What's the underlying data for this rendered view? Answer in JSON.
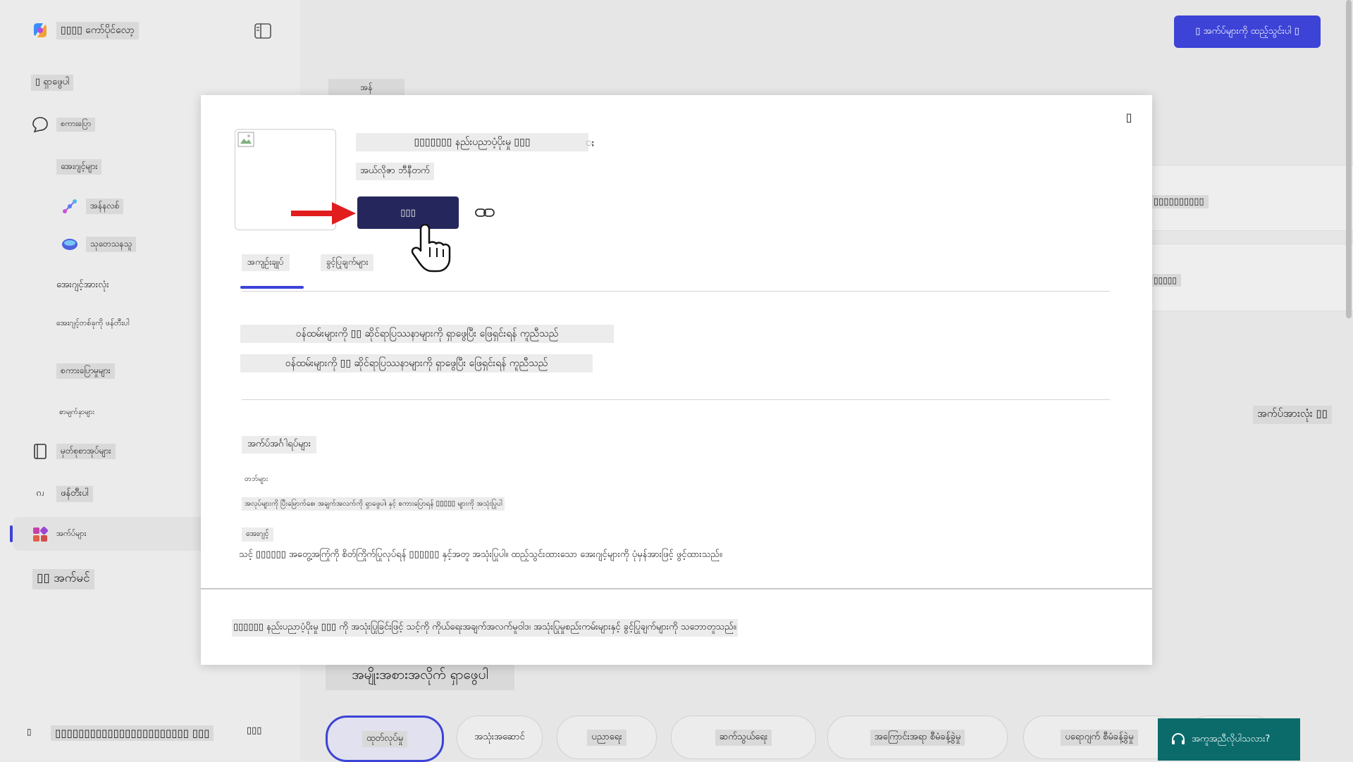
{
  "sidebar": {
    "brand": "▯▯▯▯ ကော်ပိုင်လော့",
    "search": "▯ ရှာဖွေပါ",
    "chat": "စကားပြော",
    "agents": "အေးဂျင့်များ",
    "researcher": "အန်နလစ်",
    "analyst": "သုတေသနသူ",
    "all_agents": "အေးဂျင့်အားလုံး",
    "create_agent": "အေးဂျင့်တစ်ခုကို ဖန်တီးပါ",
    "conversations": "စကားပြောမှုများ",
    "recent": "စာမျက်နှာများ",
    "notebooks": "မှတ်စုစာအုပ်များ",
    "create": "ဖန်တီးပါ",
    "apps": "အက်ပ်များ",
    "more_apps": "▯▯ အက်မင်",
    "user_name": "▯▯▯▯▯▯▯▯▯▯▯▯▯▯▯▯▯▯▯▯▯▯▯ ▯▯▯",
    "user_menu": "▯▯▯"
  },
  "main": {
    "top_button": "▯ အက်ပ်များကို ထည့်သွင်းပါ ▯",
    "tab_label": "အန်",
    "card1": "▯▯▯▯▯▯▯▯▯▯",
    "card2": "▯▯▯▯▯",
    "see_all": "အက်ပ်အားလုံး ▯▯",
    "browse_heading": "အမျိုးအစားအလိုက် ရှာဖွေပါ",
    "categories": [
      "ထုတ်လုပ်မှု",
      "အသုံးအဆောင်",
      "ပညာရေး",
      "ဆက်သွယ်ရေး",
      "အကြောင်းအရာ စီမံခန့်ခွဲမှု",
      "ပရောဂျက် စီမံခန့်ခွဲမှု"
    ],
    "help": "အကူအညီလိုပါသလား?"
  },
  "modal": {
    "close": "▯",
    "title": "▯▯▯▯▯▯▯ နည်းပညာပံ့ပိုးမှု ▯▯▯",
    "title_suffix": "ႈ",
    "publisher": "အယ်လိုဇာ ဘီနီတက်",
    "add_button": "▯▯▯",
    "tabs": [
      "အကျဉ်းချုပ်",
      "ခွင့်ပြုချက်များ"
    ],
    "desc1": "ဝန်ထမ်းများကို ▯▯ ဆိုင်ရာပြဿနာများကို ရှာဖွေပြီး ဖြေရှင်းရန် ကူညီသည်",
    "desc2": "ဝန်ထမ်းများကို ▯▯ ဆိုင်ရာပြဿနာများကို ရှာဖွေပြီး ဖြေရှင်းရန် ကူညီသည်",
    "features_heading": "အက်ပ်အင်္ဂါရပ်များ",
    "tabs_label": "တဘ်များ",
    "tabs_desc": "အလုပ်များကို ပြီးမြောက်စေ၊ အချက်အလက်ကို ရှာဖွေပါ၊ နှင့် စကားပြောရန် ▯▯▯▯▯ များကို အသုံးပြုပါ",
    "agent_label": "အေးဂျင့်",
    "agent_desc": "သင့် ▯▯▯▯▯▯ အတွေ့အကြုံကို စိတ်ကြိုက်ပြုလုပ်ရန် ▯▯▯▯▯▯ နှင့်အတူ အသုံးပြုပါ။ ထည့်သွင်းထားသော အေးဂျင့်များကို ပုံမှန်အားဖြင့် ဖွင့်ထားသည်။",
    "footer": "▯▯▯▯▯▯ နည်းပညာပံ့ပိုးမှု ▯▯▯ ကို အသုံးပြုခြင်းဖြင့် သင့်ကို ကိုယ်ရေးအချက်အလက်မူဝါဒ၊ အသုံးပြုမှုစည်းကမ်းများနှင့် ခွင့်ပြုချက်များကို သဘောတူသည်။"
  },
  "colors": {
    "accent": "#3b43d6",
    "add_button": "#25275c",
    "arrow": "#e11d1d",
    "help": "#0b6b6b"
  }
}
